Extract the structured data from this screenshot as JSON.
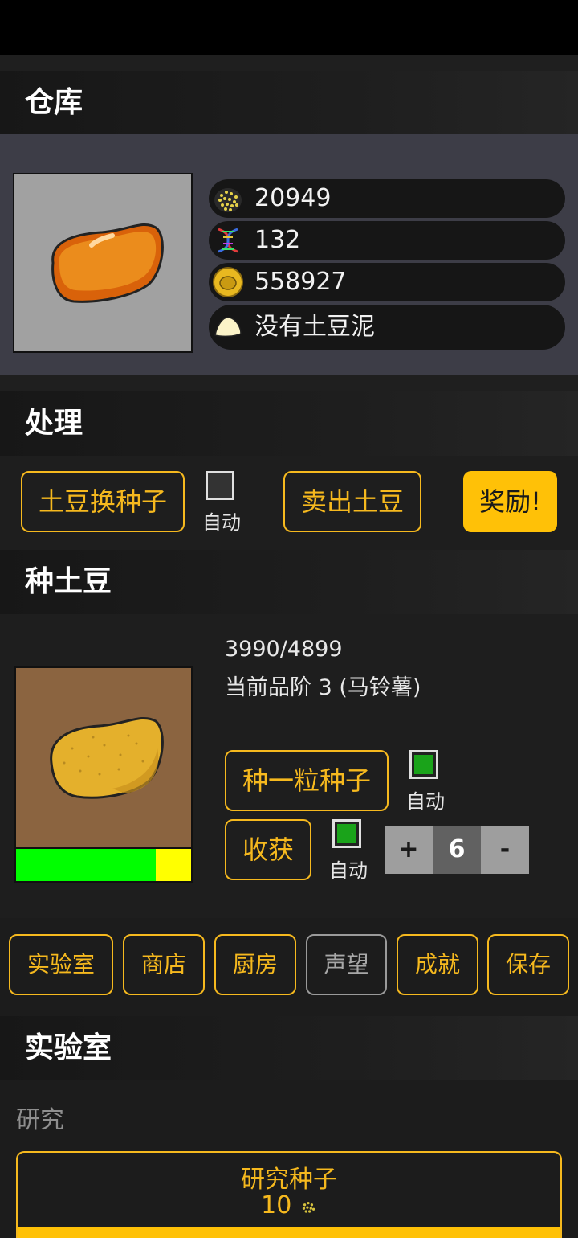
{
  "sections": {
    "warehouse_title": "仓库",
    "process_title": "处理",
    "plant_title": "种土豆",
    "lab_title": "实验室"
  },
  "resources": [
    {
      "icon": "seeds-icon",
      "value": "20949"
    },
    {
      "icon": "dna-icon",
      "value": "132"
    },
    {
      "icon": "coin-icon",
      "value": "558927"
    },
    {
      "icon": "mashed-potato-icon",
      "value": "没有土豆泥"
    }
  ],
  "process": {
    "convert_label": "土豆换种子",
    "auto_label": "自动",
    "auto_checked": false,
    "sell_label": "卖出土豆",
    "reward_label": "奖励!"
  },
  "plant": {
    "progress_text": "3990/4899",
    "tier_text": "当前品阶 3 (马铃薯)",
    "growth_fraction": 0.8,
    "plant_seed_label": "种一粒种子",
    "plant_auto_label": "自动",
    "plant_auto_checked": true,
    "harvest_label": "收获",
    "harvest_auto_label": "自动",
    "harvest_auto_checked": true,
    "stepper": {
      "plus": "+",
      "value": "6",
      "minus": "-"
    }
  },
  "nav": [
    "实验室",
    "商店",
    "厨房",
    "声望",
    "成就",
    "保存"
  ],
  "lab": {
    "research_label": "研究",
    "research_seed_title": "研究种子",
    "research_seed_cost": "10"
  },
  "colors": {
    "accent": "#f6b91e",
    "growth_green": "#00ff00",
    "growth_yellow": "#ffff00",
    "checkbox_on": "#1aa31a"
  }
}
